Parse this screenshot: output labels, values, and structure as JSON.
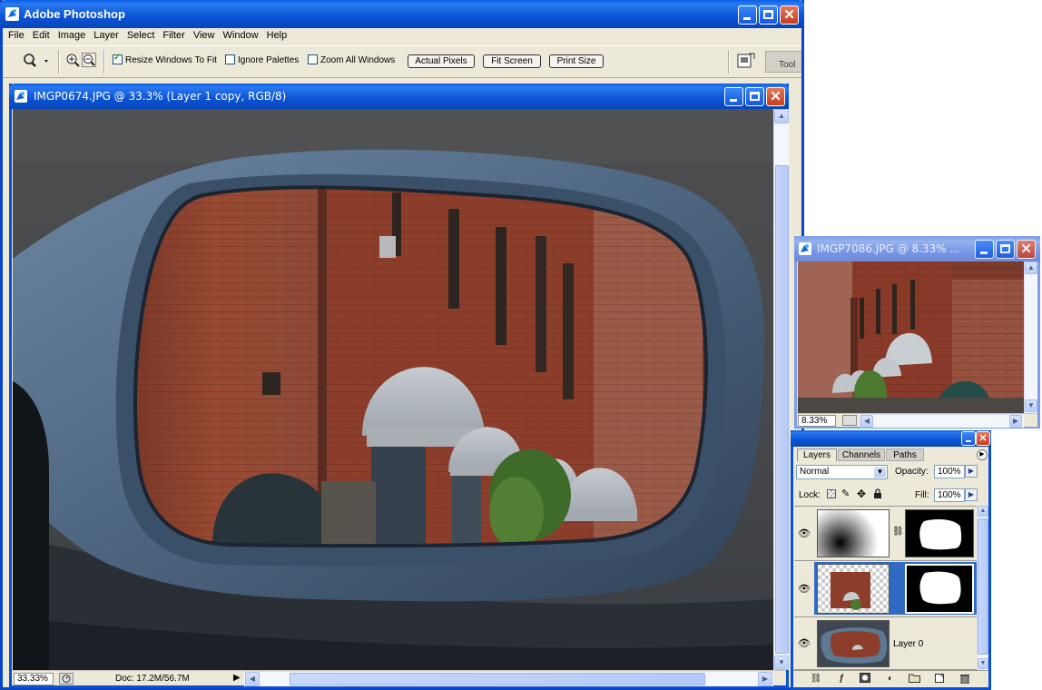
{
  "app": {
    "title": "Adobe Photoshop",
    "menu": [
      "File",
      "Edit",
      "Image",
      "Layer",
      "Select",
      "Filter",
      "View",
      "Window",
      "Help"
    ]
  },
  "options_bar": {
    "resize_windows": "Resize Windows To Fit",
    "ignore_palettes": "Ignore Palettes",
    "zoom_all": "Zoom All Windows",
    "actual_pixels": "Actual Pixels",
    "fit_screen": "Fit Screen",
    "print_size": "Print Size",
    "tool_tab": "Tool"
  },
  "main_doc": {
    "title": "IMGP0674.JPG @ 33.3% (Layer 1 copy, RGB/8)",
    "zoom": "33.33%",
    "doc_info": "Doc: 17.2M/56.7M"
  },
  "second_doc": {
    "title": "IMGP7086.JPG @ 8.33% ...",
    "zoom": "8.33%"
  },
  "layers_panel": {
    "tabs": [
      "Layers",
      "Channels",
      "Paths"
    ],
    "blend_mode": "Normal",
    "opacity_label": "Opacity:",
    "opacity": "100%",
    "lock_label": "Lock:",
    "fill_label": "Fill:",
    "fill": "100%",
    "layers": [
      {
        "name": ""
      },
      {
        "name": ""
      },
      {
        "name": "Layer 0"
      }
    ]
  }
}
